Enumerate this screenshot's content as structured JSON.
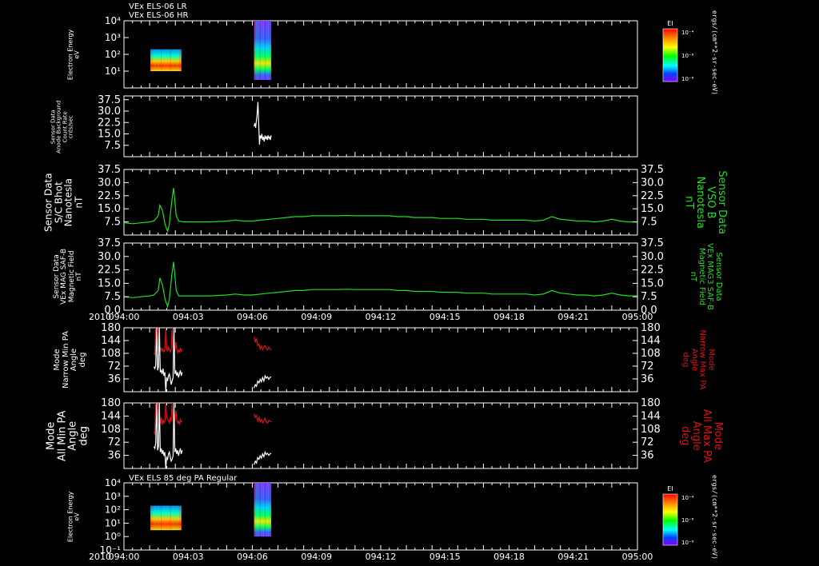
{
  "headers": {
    "top_line1": "VEx ELS-06 LR",
    "top_line2": "VEx ELS-06 HR",
    "bottom": "VEx ELS 85 deg PA Regular"
  },
  "year_label": "2010",
  "panels": {
    "p1": {
      "label_lines": [
        "Electron Energy",
        "eV"
      ]
    },
    "p2": {
      "label_lines": [
        "Sensor Data",
        "Anode Background",
        "Count Rate",
        "cnts/sec"
      ]
    },
    "p3": {
      "label_lines": [
        "Sensor Data",
        "S/C Bhot",
        "Nanotesla",
        "nT"
      ],
      "right_label_lines": [
        "Sensor Data",
        "VSO B",
        "Nanotesla",
        "nT"
      ]
    },
    "p4": {
      "label_lines": [
        "Sensor Data",
        "VEx MAG SAF-B",
        "Magnetic Field",
        "nT"
      ],
      "right_label_lines": [
        "Sensor Data",
        "VEx MAG3 SAF-B",
        "Magnetic Field",
        "nT"
      ]
    },
    "p5": {
      "label_lines": [
        "Mode",
        "Narrow Min PA",
        "Angle",
        "deg"
      ],
      "right_label_lines": [
        "Mode",
        "Narrow Max PA",
        "Angle",
        "deg"
      ]
    },
    "p6": {
      "label_lines": [
        "Mode",
        "All Min PA",
        "Angle",
        "deg"
      ],
      "right_label_lines": [
        "Mode",
        "All Max PA",
        "Angle",
        "deg"
      ]
    },
    "p7": {
      "label_lines": [
        "Electron Energy",
        "eV"
      ]
    }
  },
  "colorbar": {
    "title": "EI",
    "units": "ergs/(cm**2-sr-sec-eV)",
    "tick_labels": [
      "10⁻⁴",
      "10⁻⁸",
      "10⁻⁸"
    ]
  },
  "colors": {
    "background": "#000000",
    "magnetic_trace": "#22dd22",
    "max_pa_trace": "#dd1111",
    "min_pa_trace": "#ffffff",
    "right_label_green": "#22dd22",
    "right_label_red": "#dd1111"
  },
  "chart_data": [
    {
      "type": "heatmap",
      "title": "VEx ELS-06 LR / VEx ELS-06 HR",
      "ylabel": "Electron Energy eV",
      "y_scale": "log",
      "ylim": [
        1,
        10000
      ],
      "y_tick_labels": [
        "10⁴",
        "10³",
        "10²",
        "10¹"
      ],
      "x_range": [
        "094:00",
        "095:00"
      ],
      "data_blocks": [
        {
          "x_start": "094:03.1",
          "x_end": "094:06.7",
          "y_min": 10,
          "y_max": 200
        },
        {
          "x_start": "094:15.2",
          "x_end": "094:17.2",
          "y_min": 3,
          "y_max": 10000
        }
      ]
    },
    {
      "type": "line",
      "ylabel": "Sensor Data Anode Background Count Rate cnts/sec",
      "ylim": [
        0,
        40
      ],
      "y_ticks": [
        7.5,
        15.0,
        22.5,
        30.0,
        37.5
      ],
      "x_range": [
        "094:00",
        "095:00"
      ],
      "series": [
        {
          "x_start_min": 15.2,
          "x_end_min": 17.2,
          "values": [
            20,
            22,
            19,
            24,
            28,
            36,
            21,
            8,
            14,
            12,
            15,
            11,
            13,
            10,
            14,
            12,
            13,
            11,
            14,
            12,
            13,
            11,
            14
          ]
        }
      ]
    },
    {
      "type": "line",
      "ylabel": "Sensor Data S/C Bhot Nanotesla nT",
      "y2label": "Sensor Data VSO B Nanotesla nT",
      "ylim": [
        0,
        37.5
      ],
      "y_ticks": [
        7.5,
        15.0,
        22.5,
        30.0,
        37.5
      ],
      "x": [
        0,
        1,
        2,
        3,
        3.5,
        4,
        4.2,
        4.5,
        4.8,
        5.1,
        5.3,
        5.6,
        5.8,
        6.1,
        6.4,
        7,
        8,
        10,
        12,
        13,
        14,
        15,
        16,
        17,
        18,
        19,
        20,
        21,
        22,
        23,
        24,
        25,
        26,
        27,
        28,
        29,
        30,
        31,
        32,
        33,
        34,
        35,
        36,
        37,
        38,
        39,
        40,
        41,
        42,
        43,
        44,
        45,
        46,
        47,
        48,
        49,
        50,
        51,
        52,
        53,
        54,
        55,
        56,
        57,
        58,
        59,
        60
      ],
      "series": [
        {
          "values": [
            7,
            6.5,
            7,
            7.5,
            8,
            11,
            17,
            14,
            6,
            2,
            6,
            20,
            27,
            11,
            8,
            7.5,
            7.5,
            7.5,
            8,
            8.5,
            8,
            8,
            8.5,
            9,
            9.5,
            10,
            10.5,
            10.5,
            11,
            11,
            11,
            11,
            11.2,
            11,
            11,
            11,
            11,
            11,
            10.5,
            10.5,
            10,
            10,
            10,
            9.5,
            9.5,
            9.5,
            9,
            9,
            9,
            8.5,
            8.5,
            8.5,
            8.5,
            8.5,
            8,
            8.5,
            10.5,
            9,
            8.5,
            8,
            8,
            7.5,
            8,
            9,
            8,
            7.5,
            7.5
          ]
        }
      ]
    },
    {
      "type": "line",
      "ylabel": "Sensor Data VEx MAG SAF-B Magnetic Field nT",
      "y2label": "Sensor Data VEx MAG3 SAF-B Magnetic Field nT",
      "ylim": [
        0,
        37.5
      ],
      "y_ticks": [
        0.0,
        7.5,
        15.0,
        22.5,
        30.0,
        37.5
      ],
      "x": [
        0,
        1,
        2,
        3,
        3.5,
        4,
        4.2,
        4.5,
        4.8,
        5.1,
        5.3,
        5.6,
        5.8,
        6.1,
        6.4,
        7,
        8,
        10,
        12,
        13,
        14,
        15,
        16,
        17,
        18,
        19,
        20,
        21,
        22,
        23,
        24,
        25,
        26,
        27,
        28,
        29,
        30,
        31,
        32,
        33,
        34,
        35,
        36,
        37,
        38,
        39,
        40,
        41,
        42,
        43,
        44,
        45,
        46,
        47,
        48,
        49,
        50,
        51,
        52,
        53,
        54,
        55,
        56,
        57,
        58,
        59,
        60
      ],
      "series": [
        {
          "values": [
            7.5,
            7,
            7.5,
            8,
            8.5,
            11,
            18,
            14,
            6,
            2,
            6,
            20,
            27,
            11,
            8,
            8,
            8,
            8,
            8.5,
            9,
            8.5,
            8.5,
            9,
            9.5,
            10,
            10.5,
            11,
            11,
            11.5,
            11.5,
            11.5,
            11.5,
            11.7,
            11.5,
            11.5,
            11.5,
            11.5,
            11.5,
            11,
            11,
            10.5,
            10.5,
            10.5,
            10,
            10,
            10,
            9.5,
            9.5,
            9.5,
            9,
            9,
            9,
            9,
            9,
            8.5,
            9,
            11,
            9.5,
            9,
            8.5,
            8.5,
            8,
            8.5,
            9.5,
            8.5,
            8,
            8
          ]
        }
      ]
    },
    {
      "type": "line",
      "ylabel": "Mode Narrow Min PA Angle deg",
      "y2label": "Mode Narrow Max PA Angle deg",
      "ylim": [
        0,
        180
      ],
      "y_ticks": [
        36,
        72,
        108,
        144,
        180
      ],
      "x_range": [
        "094:00",
        "095:00"
      ],
      "series": [
        {
          "name": "Narrow Max PA",
          "segments": [
            {
              "x_start_min": 3.5,
              "x_end_min": 6.8,
              "values": [
                110,
                105,
                180,
                120,
                115,
                180,
                125,
                118,
                122,
                115,
                120,
                112,
                118,
                180,
                120,
                115,
                125,
                118,
                112,
                120,
                180,
                125,
                118,
                115,
                140,
                120,
                110,
                118,
                112,
                122,
                115,
                120
              ]
            },
            {
              "x_start_min": 15.2,
              "x_end_min": 17.2,
              "values": [
                155,
                140,
                150,
                130,
                135,
                120,
                128,
                118,
                125,
                130,
                122,
                118,
                125,
                120,
                118
              ]
            }
          ]
        },
        {
          "name": "Narrow Min PA",
          "segments": [
            {
              "x_start_min": 3.5,
              "x_end_min": 6.8,
              "values": [
                70,
                65,
                75,
                180,
                60,
                70,
                180,
                55,
                60,
                50,
                65,
                45,
                55,
                0,
                40,
                30,
                45,
                50,
                35,
                20,
                30,
                40,
                180,
                50,
                60,
                45,
                55,
                40,
                50,
                60,
                45,
                55
              ]
            },
            {
              "x_start_min": 15.2,
              "x_end_min": 17.2,
              "values": [
                10,
                20,
                15,
                30,
                25,
                35,
                28,
                40,
                30,
                45,
                38,
                42,
                35,
                40,
                42
              ]
            }
          ]
        }
      ]
    },
    {
      "type": "line",
      "ylabel": "Mode All Min PA Angle deg",
      "y2label": "Mode All Max PA Angle deg",
      "ylim": [
        0,
        180
      ],
      "y_ticks": [
        36,
        72,
        108,
        144,
        180
      ],
      "x_range": [
        "094:00",
        "095:00"
      ],
      "series": [
        {
          "name": "All Max PA",
          "segments": [
            {
              "x_start_min": 3.5,
              "x_end_min": 6.8,
              "values": [
                100,
                95,
                180,
                120,
                115,
                180,
                130,
                125,
                140,
                120,
                135,
                125,
                130,
                180,
                140,
                135,
                130,
                125,
                140,
                130,
                180,
                135,
                140,
                130,
                160,
                135,
                125,
                130,
                120,
                135,
                128,
                130
              ]
            },
            {
              "x_start_min": 15.2,
              "x_end_min": 17.2,
              "values": [
                150,
                140,
                145,
                130,
                140,
                128,
                135,
                125,
                132,
                138,
                128,
                125,
                132,
                130,
                128
              ]
            }
          ]
        },
        {
          "name": "All Min PA",
          "segments": [
            {
              "x_start_min": 3.5,
              "x_end_min": 6.8,
              "values": [
                60,
                55,
                70,
                180,
                50,
                60,
                180,
                45,
                55,
                40,
                50,
                35,
                45,
                0,
                30,
                25,
                40,
                45,
                30,
                20,
                25,
                35,
                180,
                45,
                55,
                40,
                50,
                35,
                45,
                55,
                40,
                50
              ]
            },
            {
              "x_start_min": 15.2,
              "x_end_min": 17.2,
              "values": [
                10,
                20,
                15,
                30,
                25,
                35,
                28,
                40,
                32,
                45,
                38,
                42,
                36,
                40,
                42
              ]
            }
          ]
        }
      ]
    },
    {
      "type": "heatmap",
      "title": "VEx ELS 85 deg PA Regular",
      "ylabel": "Electron Energy eV",
      "y_scale": "log",
      "ylim": [
        0.1,
        10000
      ],
      "y_tick_labels": [
        "10⁴",
        "10³",
        "10²",
        "10¹",
        "10⁰",
        "10⁻¹"
      ],
      "x_range": [
        "094:00",
        "095:00"
      ],
      "x_tick_labels": [
        "094:00",
        "094:03",
        "094:06",
        "094:09",
        "094:12",
        "094:15",
        "094:18",
        "094:21",
        "095:00"
      ],
      "data_blocks": [
        {
          "x_start": "094:03.1",
          "x_end": "094:06.7",
          "y_min": 3,
          "y_max": 200
        },
        {
          "x_start": "094:15.2",
          "x_end": "094:17.2",
          "y_min": 1,
          "y_max": 10000
        }
      ]
    }
  ]
}
